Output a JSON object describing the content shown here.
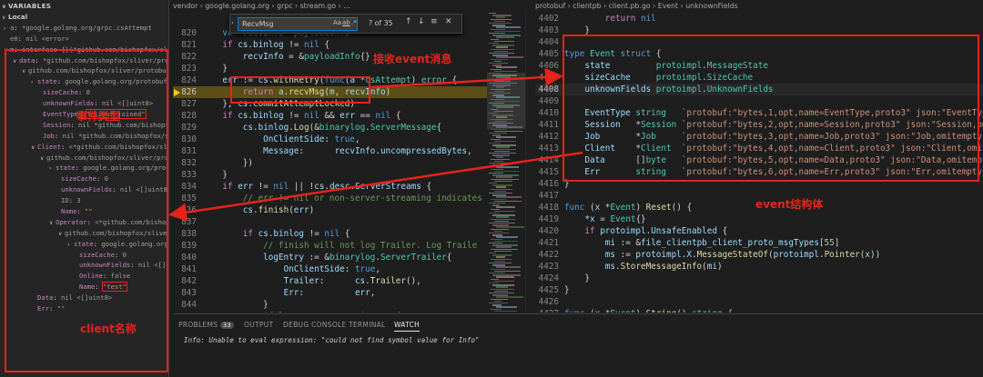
{
  "variables": {
    "header": "VARIABLES",
    "scope": "Local",
    "rows": [
      {
        "chev": "›",
        "indent": 4,
        "name": "a",
        "value": "*google.golang.org/grpc.csAttempt"
      },
      {
        "chev": "",
        "indent": 4,
        "name": "e0",
        "value": "nil <error>"
      },
      {
        "chev": "∨",
        "indent": 4,
        "name": "m",
        "value": "interface {}(*github.com/bishopfox/sliver/protobuf/clientpb.Event)"
      },
      {
        "chev": "∨",
        "indent": 14,
        "name": "data",
        "value": "*github.com/bishopfox/sliver/protobuf/clientpb.Event"
      },
      {
        "chev": "∨",
        "indent": 24,
        "name": "",
        "value": "github.com/bishopfox/sliver/protobuf/clientpb.Event"
      },
      {
        "chev": "›",
        "indent": 34,
        "name": "state",
        "value": "google.golang.org/protobuf/internal/impl.MessageState"
      },
      {
        "chev": "",
        "indent": 40,
        "name": "sizeCache",
        "value": "0"
      },
      {
        "chev": "",
        "indent": 40,
        "name": "unknownFields",
        "value": "nil <[]uint8>"
      },
      {
        "chev": "",
        "indent": 40,
        "name": "EventType",
        "value": "\"client-joined\"",
        "str": true
      },
      {
        "chev": "",
        "indent": 40,
        "name": "Session",
        "value": "nil *github.com/bishopfox/sliver/protobuf/clientpb.Session"
      },
      {
        "chev": "",
        "indent": 40,
        "name": "Job",
        "value": "nil *github.com/bishopfox/sliver/protobuf/clientpb.Job"
      },
      {
        "chev": "∨",
        "indent": 34,
        "name": "Client",
        "value": "<*github.com/bishopfox/sliver/protobuf/clientpb.Client>"
      },
      {
        "chev": "∨",
        "indent": 44,
        "name": "",
        "value": "github.com/bishopfox/sliver/protobuf/clientpb.Client"
      },
      {
        "chev": "›",
        "indent": 54,
        "name": "state",
        "value": "google.golang.org/protobuf/internal/impl.MessageState"
      },
      {
        "chev": "",
        "indent": 60,
        "name": "sizeCache",
        "value": "0"
      },
      {
        "chev": "",
        "indent": 60,
        "name": "unknownFields",
        "value": "nil <[]uint8>"
      },
      {
        "chev": "",
        "indent": 60,
        "name": "ID",
        "value": "3"
      },
      {
        "chev": "",
        "indent": 60,
        "name": "Name",
        "value": "\"\"",
        "str": true
      },
      {
        "chev": "∨",
        "indent": 54,
        "name": "Operator",
        "value": "<*github.com/bishopfox/sliver/protobuf/clientpb.Operator>"
      },
      {
        "chev": "∨",
        "indent": 64,
        "name": "",
        "value": "github.com/bishopfox/sliver/protobuf/clientpb.Operator"
      },
      {
        "chev": "›",
        "indent": 74,
        "name": "state",
        "value": "google.golang.org/protobuf/internal/impl.MessageState"
      },
      {
        "chev": "",
        "indent": 80,
        "name": "sizeCache",
        "value": "0"
      },
      {
        "chev": "",
        "indent": 80,
        "name": "unknownFields",
        "value": "nil <[]uint8>"
      },
      {
        "chev": "",
        "indent": 80,
        "name": "Online",
        "value": "false"
      },
      {
        "chev": "",
        "indent": 80,
        "name": "Name",
        "value": "\"test\"",
        "str": true
      },
      {
        "chev": "",
        "indent": 34,
        "name": "Data",
        "value": "nil <[]uint8>"
      },
      {
        "chev": "",
        "indent": 34,
        "name": "Err",
        "value": "\"\"",
        "str": true
      }
    ]
  },
  "left_editor": {
    "breadcrumbs": [
      "vendor",
      "google.golang.org",
      "grpc",
      "stream.go",
      "..."
    ],
    "find": {
      "query": "RecvMsg",
      "count": "? of 35",
      "aa": "Aa",
      "ab": "ab",
      "re": ".*"
    },
    "lines": [
      {
        "n": "820",
        "html": "    <span class='kb'>var</span> <span class='id'>recvInfo</span> <span class='pl'>*</span><span class='ty'>payloadInfo</span>"
      },
      {
        "n": "821",
        "html": "    <span class='kw'>if</span> <span class='id'>cs</span><span class='pl'>.</span><span class='id'>binlog</span> <span class='pl'>!=</span> <span class='kb'>nil</span> <span class='pl'>{</span>"
      },
      {
        "n": "822",
        "html": "        <span class='id'>recvInfo</span> <span class='pl'>=</span> <span class='pl'>&amp;</span><span class='ty'>payloadInfo</span><span class='pl'>{}</span>"
      },
      {
        "n": "823",
        "html": "    <span class='pl'>}</span>"
      },
      {
        "n": "824",
        "html": "    <span class='id'>err</span> <span class='pl'>:=</span> <span class='id'>cs</span><span class='pl'>.</span><span class='fn'>withRetry</span><span class='pl'>(</span><span class='kb'>func</span><span class='pl'>(</span><span class='id'>a</span> <span class='pl'>*</span><span class='ty'>csAttempt</span><span class='pl'>)</span> <span class='ty'>error</span> <span class='pl'>{</span>"
      },
      {
        "n": "826",
        "html": "        <span class='kw'>return</span> <span class='id'>a</span><span class='pl'>.</span><span class='fn'>recvMsg</span><span class='pl'>(</span><span class='id'>m</span><span class='pl'>,</span> <span class='id'>recvInfo</span><span class='pl'>)</span>",
        "hl": true
      },
      {
        "n": "827",
        "html": "    <span class='pl'>},</span> <span class='id'>cs</span><span class='pl'>.</span><span class='fn'>commitAttemptLocked</span><span class='pl'>)</span>"
      },
      {
        "n": "828",
        "html": "    <span class='kw'>if</span> <span class='id'>cs</span><span class='pl'>.</span><span class='id'>binlog</span> <span class='pl'>!=</span> <span class='kb'>nil</span> <span class='pl'>&amp;&amp;</span> <span class='id'>err</span> <span class='pl'>==</span> <span class='kb'>nil</span> <span class='pl'>{</span>"
      },
      {
        "n": "829",
        "html": "        <span class='id'>cs</span><span class='pl'>.</span><span class='id'>binlog</span><span class='pl'>.</span><span class='fn'>Log</span><span class='pl'>(&amp;</span><span class='ty'>binarylog</span><span class='pl'>.</span><span class='ty'>ServerMessage</span><span class='pl'>{</span>"
      },
      {
        "n": "830",
        "html": "            <span class='id'>OnClientSide</span><span class='pl'>:</span> <span class='kb'>true</span><span class='pl'>,</span>"
      },
      {
        "n": "831",
        "html": "            <span class='id'>Message</span><span class='pl'>:</span>      <span class='id'>recvInfo</span><span class='pl'>.</span><span class='id'>uncompressedBytes</span><span class='pl'>,</span>"
      },
      {
        "n": "832",
        "html": "        <span class='pl'>})</span>"
      },
      {
        "n": "833",
        "html": "    <span class='pl'>}</span>"
      },
      {
        "n": "834",
        "html": "    <span class='kw'>if</span> <span class='id'>err</span> <span class='pl'>!=</span> <span class='kb'>nil</span> <span class='pl'>||</span> <span class='pl'>!</span><span class='id'>cs</span><span class='pl'>.</span><span class='id'>desc</span><span class='pl'>.</span><span class='id'>ServerStreams</span> <span class='pl'>{</span>"
      },
      {
        "n": "835",
        "html": "        <span class='cm'>// err != nil or non-server-streaming indicates</span>"
      },
      {
        "n": "836",
        "html": "        <span class='id'>cs</span><span class='pl'>.</span><span class='fn'>finish</span><span class='pl'>(</span><span class='id'>err</span><span class='pl'>)</span>"
      },
      {
        "n": "837",
        "html": ""
      },
      {
        "n": "838",
        "html": "        <span class='kw'>if</span> <span class='id'>cs</span><span class='pl'>.</span><span class='id'>binlog</span> <span class='pl'>!=</span> <span class='kb'>nil</span> <span class='pl'>{</span>"
      },
      {
        "n": "839",
        "html": "            <span class='cm'>// finish will not log Trailer. Log Traile</span>"
      },
      {
        "n": "840",
        "html": "            <span class='id'>logEntry</span> <span class='pl'>:=</span> <span class='pl'>&amp;</span><span class='ty'>binarylog</span><span class='pl'>.</span><span class='ty'>ServerTrailer</span><span class='pl'>{</span>"
      },
      {
        "n": "841",
        "html": "                <span class='id'>OnClientSide</span><span class='pl'>:</span> <span class='kb'>true</span><span class='pl'>,</span>"
      },
      {
        "n": "842",
        "html": "                <span class='id'>Trailer</span><span class='pl'>:</span>      <span class='id'>cs</span><span class='pl'>.</span><span class='fn'>Trailer</span><span class='pl'>(),</span>"
      },
      {
        "n": "843",
        "html": "                <span class='id'>Err</span><span class='pl'>:</span>          <span class='id'>err</span><span class='pl'>,</span>"
      },
      {
        "n": "844",
        "html": "            <span class='pl'>}</span>"
      },
      {
        "n": "845",
        "html": "            <span class='kw'>if</span> <span class='id'>logEntry</span><span class='pl'>.</span><span class='id'>Err</span> <span class='pl'>==</span> <span class='id'>io</span><span class='pl'>.</span><span class='id'>EOF</span> <span class='pl'>{</span>"
      },
      {
        "n": "846",
        "html": "                <span class='id'>logEntry</span><span class='pl'>.</span><span class='id'>Err</span> <span class='pl'>=</span> <span class='kb'>nil</span>"
      }
    ]
  },
  "right_editor": {
    "breadcrumbs": [
      "protobuf",
      "clientpb",
      "client.pb.go",
      "Event",
      "unknownFields"
    ],
    "lines": [
      {
        "n": "4402",
        "html": "        <span class='kw'>return</span> <span class='kb'>nil</span>"
      },
      {
        "n": "4403",
        "html": "    <span class='pl'>}</span>"
      },
      {
        "n": "4404",
        "html": ""
      },
      {
        "n": "4405",
        "html": "<span class='kb'>type</span> <span class='ty'>Event</span> <span class='kb'>struct</span> <span class='pl'>{</span>"
      },
      {
        "n": "4406",
        "html": "    <span class='id'>state</span>         <span class='ty'>protoimpl</span><span class='pl'>.</span><span class='ty'>MessageState</span>"
      },
      {
        "n": "4407",
        "html": "    <span class='id'>sizeCache</span>     <span class='ty'>protoimpl</span><span class='pl'>.</span><span class='ty'>SizeCache</span>"
      },
      {
        "n": "4408",
        "html": "    <span class='id'>unknownFields</span> <span class='ty'>protoimpl</span><span class='pl'>.</span><span class='ty'>UnknownFields</span>",
        "cur": true
      },
      {
        "n": "4409",
        "html": ""
      },
      {
        "n": "4410",
        "html": "    <span class='id'>EventType</span> <span class='ty'>string</span>   <span class='str'>`protobuf:\"bytes,1,opt,name=EventType,proto3\" json:\"EventType,omitempty\"`</span>"
      },
      {
        "n": "4411",
        "html": "    <span class='id'>Session</span>   <span class='pl'>*</span><span class='ty'>Session</span> <span class='str'>`protobuf:\"bytes,2,opt,name=Session,proto3\" json:\"Session,omitempty\"`</span>"
      },
      {
        "n": "4412",
        "html": "    <span class='id'>Job</span>       <span class='pl'>*</span><span class='ty'>Job</span>     <span class='str'>`protobuf:\"bytes,3,opt,name=Job,proto3\" json:\"Job,omitempty\"`</span>"
      },
      {
        "n": "4413",
        "html": "    <span class='id'>Client</span>    <span class='pl'>*</span><span class='ty'>Client</span>  <span class='str'>`protobuf:\"bytes,4,opt,name=Client,proto3\" json:\"Client,omitempty\"`</span>"
      },
      {
        "n": "4414",
        "html": "    <span class='id'>Data</span>      <span class='pl'>[]</span><span class='ty'>byte</span>   <span class='str'>`protobuf:\"bytes,5,opt,name=Data,proto3\" json:\"Data,omitempty\"`</span>"
      },
      {
        "n": "4415",
        "html": "    <span class='id'>Err</span>       <span class='ty'>string</span>   <span class='str'>`protobuf:\"bytes,6,opt,name=Err,proto3\" json:\"Err,omitempty\"`</span>"
      },
      {
        "n": "4416",
        "html": "<span class='pl'>}</span>"
      },
      {
        "n": "4417",
        "html": ""
      },
      {
        "n": "4418",
        "html": "<span class='kb'>func</span> <span class='pl'>(</span><span class='id'>x</span> <span class='pl'>*</span><span class='ty'>Event</span><span class='pl'>)</span> <span class='fn'>Reset</span><span class='pl'>()</span> <span class='pl'>{</span>"
      },
      {
        "n": "4419",
        "html": "    <span class='pl'>*</span><span class='id'>x</span> <span class='pl'>=</span> <span class='ty'>Event</span><span class='pl'>{}</span>"
      },
      {
        "n": "4420",
        "html": "    <span class='kw'>if</span> <span class='id'>protoimpl</span><span class='pl'>.</span><span class='id'>UnsafeEnabled</span> <span class='pl'>{</span>"
      },
      {
        "n": "4421",
        "html": "        <span class='id'>mi</span> <span class='pl'>:=</span> <span class='pl'>&amp;</span><span class='id'>file_clientpb_client_proto_msgTypes</span><span class='pl'>[</span><span class='num'>55</span><span class='pl'>]</span>"
      },
      {
        "n": "4422",
        "html": "        <span class='id'>ms</span> <span class='pl'>:=</span> <span class='id'>protoimpl</span><span class='pl'>.</span><span class='id'>X</span><span class='pl'>.</span><span class='fn'>MessageStateOf</span><span class='pl'>(</span><span class='id'>protoimpl</span><span class='pl'>.</span><span class='fn'>Pointer</span><span class='pl'>(</span><span class='id'>x</span><span class='pl'>))</span>"
      },
      {
        "n": "4423",
        "html": "        <span class='id'>ms</span><span class='pl'>.</span><span class='fn'>StoreMessageInfo</span><span class='pl'>(</span><span class='id'>mi</span><span class='pl'>)</span>"
      },
      {
        "n": "4424",
        "html": "    <span class='pl'>}</span>"
      },
      {
        "n": "4425",
        "html": "<span class='pl'>}</span>"
      },
      {
        "n": "4426",
        "html": ""
      },
      {
        "n": "4427",
        "html": "<span class='kb'>func</span> <span class='pl'>(</span><span class='id'>x</span> <span class='pl'>*</span><span class='ty'>Event</span><span class='pl'>)</span> <span class='fn'>String</span><span class='pl'>()</span> <span class='ty'>string</span> <span class='pl'>{</span>"
      },
      {
        "n": "4428",
        "html": "    <span class='kw'>return</span> <span class='id'>protoimpl</span><span class='pl'>.</span><span class='id'>X</span><span class='pl'>.</span><span class='fn'>MessageStringOf</span><span class='pl'>(</span><span class='id'>x</span><span class='pl'>)</span>"
      }
    ]
  },
  "panel": {
    "tabs": [
      "PROBLEMS",
      "OUTPUT",
      "DEBUG CONSOLE",
      "TERMINAL",
      "WATCH"
    ],
    "problems_count": "33",
    "message": "Info: Unable to eval expression: \"could not find symbol value for Info\""
  },
  "annotations": {
    "recv_event": "接收event消息",
    "event_type": "事件类型",
    "client_name": "client名称",
    "event_struct": "event结构体"
  },
  "colors": {
    "annotation": "#e8231a",
    "background": "#1e1e1e",
    "keyword": "#c586c0",
    "type": "#4ec9b0"
  }
}
